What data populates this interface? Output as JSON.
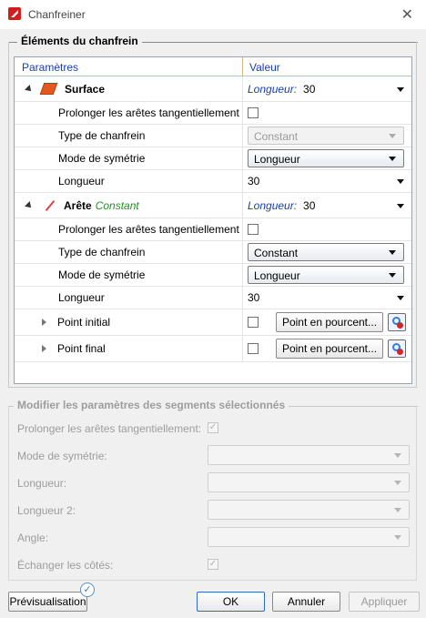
{
  "window": {
    "title": "Chanfreiner"
  },
  "group1": {
    "title": "Éléments du chanfrein"
  },
  "grid": {
    "col_params": "Paramètres",
    "col_value": "Valeur",
    "surface": {
      "name": "Surface",
      "value_label": "Longueur:",
      "value": "30",
      "prolonger": "Prolonger les arêtes tangentiellement",
      "type_label": "Type de chanfrein",
      "type_value": "Constant",
      "sym_label": "Mode de symétrie",
      "sym_value": "Longueur",
      "len_label": "Longueur",
      "len_value": "30"
    },
    "arete": {
      "name": "Arête",
      "mode": "Constant",
      "value_label": "Longueur:",
      "value": "30",
      "prolonger": "Prolonger les arêtes tangentiellement",
      "type_label": "Type de chanfrein",
      "type_value": "Constant",
      "sym_label": "Mode de symétrie",
      "sym_value": "Longueur",
      "len_label": "Longueur",
      "len_value": "30"
    },
    "point_initial": {
      "label": "Point initial",
      "button": "Point en pourcent..."
    },
    "point_final": {
      "label": "Point final",
      "button": "Point en pourcent..."
    }
  },
  "group2": {
    "title": "Modifier les paramètres des segments sélectionnés",
    "prolonger": "Prolonger les arêtes tangentiellement:",
    "sym": "Mode de symétrie:",
    "len": "Longueur:",
    "len2": "Longueur 2:",
    "angle": "Angle:",
    "swap": "Échanger les côtés:"
  },
  "footer": {
    "preview": "Prévisualisation",
    "ok": "OK",
    "cancel": "Annuler",
    "apply": "Appliquer"
  }
}
